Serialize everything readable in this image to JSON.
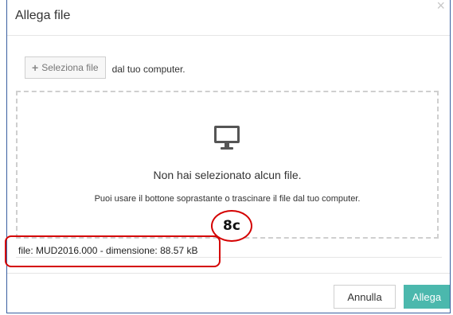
{
  "dialog": {
    "title": "Allega file",
    "close_symbol": "×"
  },
  "select": {
    "plus_symbol": "+",
    "button_label": "Seleziona file",
    "suffix": "dal tuo computer."
  },
  "dropzone": {
    "icon": "monitor-icon",
    "title": "Non hai selezionato alcun file.",
    "hint": "Puoi usare il bottone soprastante o trascinare il file dal tuo computer."
  },
  "file_info": "file: MUD2016.000 - dimensione: 88.57 kB",
  "annotation": {
    "badge_label": "8c",
    "color": "#d40000"
  },
  "footer": {
    "cancel_label": "Annulla",
    "attach_label": "Allega",
    "attach_color": "#4bb8ad"
  }
}
